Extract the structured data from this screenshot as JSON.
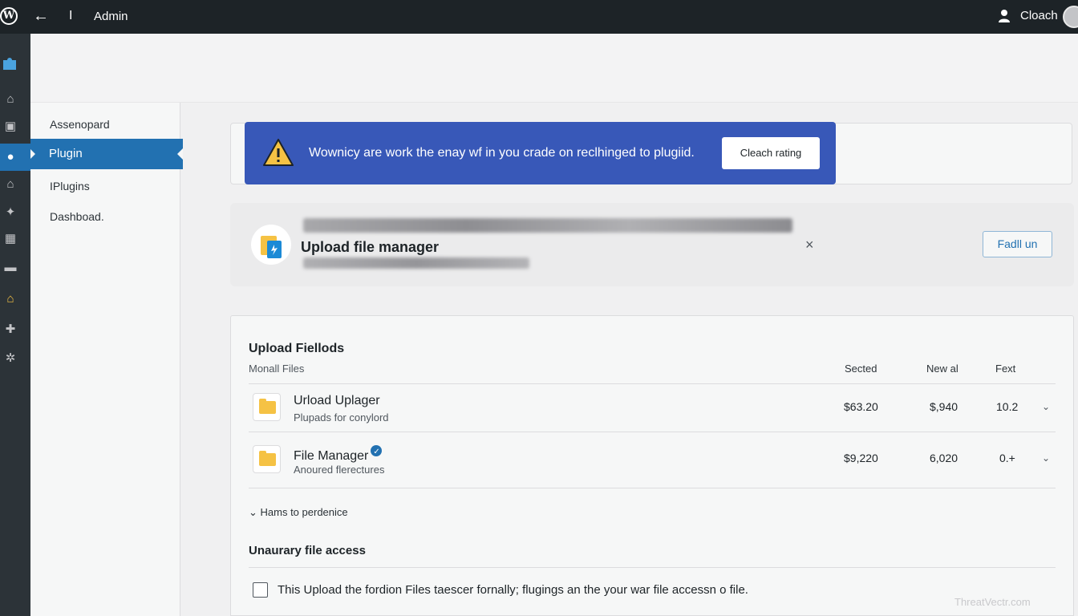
{
  "topbar": {
    "logo": "W",
    "back_icon": "←",
    "separator": "I",
    "title": "Admin",
    "user_name": "Cloach"
  },
  "icons": {
    "back": "arrow-left-icon",
    "user": "user-icon"
  },
  "submenu": {
    "items": [
      "Assenopard",
      "Plugin",
      "IPlugins",
      "Dashboad."
    ]
  },
  "notice": {
    "message": "Wownicy are work the enay wf in you crade on reclhinged to plugiid.",
    "button": "Cleach rating",
    "color": "#3858b8"
  },
  "plugin_card": {
    "name": "Upload file manager",
    "close": "×",
    "action": "Fadll un"
  },
  "panel": {
    "heading": "Upload Fiellods",
    "subheading": "Monall Files",
    "columns": [
      "Sected",
      "New al",
      "Fext"
    ],
    "rows": [
      {
        "name": "Urload Uplager",
        "desc": "Plupads for conylord",
        "v1": "$63.20",
        "v2": "$,940",
        "v3": "10.2"
      },
      {
        "name": "File Manager",
        "desc": "Anoured flerectures",
        "v1": "$9,220",
        "v2": "6,020",
        "v3": "0.+"
      }
    ],
    "more": "Hams to perdenice",
    "section_title": "Unaurary file access",
    "checkbox_label": "This Upload the fordion Files taescer fornally; flugings an the your war file accessn o file."
  },
  "watermark": "ThreatVectr.com",
  "accent_color": "#2271b1"
}
